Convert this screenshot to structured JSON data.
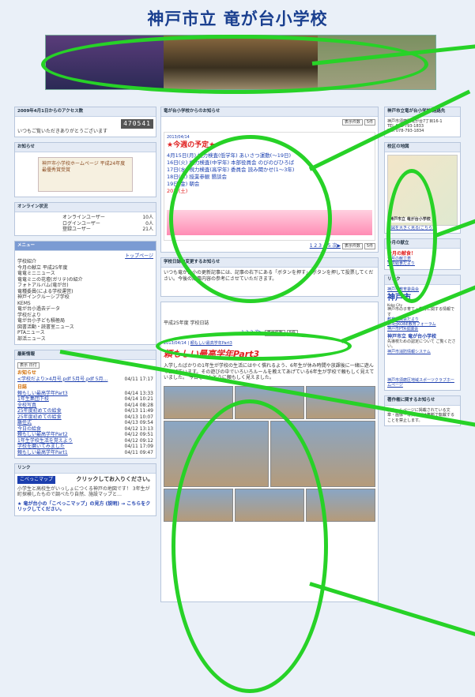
{
  "school_name": "神戸市立 竜が台小学校",
  "left": {
    "access": {
      "title": "2009年4月1日からのアクセス数",
      "count": "470541",
      "thanks": "いつもご覧いただきありがとうございます"
    },
    "award": {
      "title": "お知らせ",
      "text": "神戸市小学校ホームページ 平成24年度最優秀賞受賞"
    },
    "online": {
      "title": "オンライン状況",
      "rows": [
        {
          "label": "オンラインユーザー",
          "value": "10人"
        },
        {
          "label": "ログインユーザー",
          "value": "0人"
        },
        {
          "label": "登録ユーザー",
          "value": "21人"
        }
      ]
    },
    "menu": {
      "title": "メニュー",
      "top": "トップページ",
      "items": [
        "学校紹介",
        "今月の献立 平成25年度",
        "竜竜ミニニュース",
        "竜竜ミニの花壇(ガリテ)の紹介",
        "フォトアルバム(竜が台)",
        "竜種委員(による学校運営)",
        "神戸インクルーシブ学校",
        "KEMS",
        "竜が台小過去データ",
        "学校だより",
        "竜が台小子ども積極局",
        "図書活動・読書室ニュース",
        "PTAニュース",
        "部活ニュース"
      ]
    },
    "recent": {
      "title": "最新情報",
      "select": "表示 日付",
      "oshirase": "お知らせ",
      "oshirase_item": "<学校だより>4月号.pdf 5月号.pdf 5月…",
      "oshirase_date": "04/11 17:17",
      "nisshi_title": "日誌",
      "entries": [
        {
          "t": "頼もしい最高学年Part3",
          "d": "04/14 13:33"
        },
        {
          "t": "1年生集団下校",
          "d": "04/14 10:21"
        },
        {
          "t": "全校写真",
          "d": "04/14 08:28"
        },
        {
          "t": "25年度初めての給食",
          "d": "04/13 11:49"
        },
        {
          "t": "25年度初めての給食",
          "d": "04/13 10:07"
        },
        {
          "t": "離任式",
          "d": "04/13 09:54"
        },
        {
          "t": "今日の給食",
          "d": "04/12 13:13"
        },
        {
          "t": "頼もしい最高学年Part2",
          "d": "04/12 09:51"
        },
        {
          "t": "1年生学校生活を覚えよう",
          "d": "04/12 09:12"
        },
        {
          "t": "学校を磨いてみました",
          "d": "04/11 17:09"
        },
        {
          "t": "頼もしい最高学年Part1",
          "d": "04/11 09:47"
        }
      ]
    },
    "link": {
      "title": "リンク",
      "map_label": "こべっこマップ",
      "click_text": "クリックしてお入りください。",
      "desc": "小学生と高校生がいっしょにつくる神戸の地図です！ 3年生が町探検したもので調べたり自然、施設マップと…",
      "bottom_text": "★ 竜が台小の「こべっこマップ」の見方 (説明) → こちらをクリックしてください。"
    }
  },
  "center": {
    "notice_title": "竜が台小学校からのお知らせ",
    "schedule_date": "2013/04/14",
    "schedule_head": "★今週の予定★",
    "schedule_lines": [
      "4月15日(月) 視力検査(低学年) あいさつ運動(～19日)",
      "16日(火) 視力検査(中学年) 本部役員会 のびのびひろば",
      "17日(水) 視力検査(高学年) 委員会 読み聞かせ(1～3年)",
      "18日(木) 授業参観 懇談会",
      "19日(金) 朝会",
      "20日(土)"
    ],
    "pager": "1 2 3 4 5 次▶",
    "pager_select": "表示件数",
    "count_label": "5件",
    "nisshi_note_title": "学校日誌の変更するお知らせ",
    "nisshi_note": "いつも竜が台小の更新記事には、記事の右下にある「ボタンを押す」 ボタンを押して投票してください。今後の記事内容の参考にさせていただきます。",
    "diary_heading": "平成25年度 学校日誌",
    "diary_pager": "1 2 3 次▶",
    "diary_date": "2013/04/14",
    "diary_cat": "頼もしい最高学年Part3",
    "diary_title": "頼もしい最高学年Part3",
    "diary_text": "入学したばかりの1年生が学校の生活にはやく慣れるよう、6年生が休み時間や放課後に一緒に遊んであげています。その遊びの中でいろいろルールを教えてあげている6年生が学校で頼もしく見えていました。 今日もほんとうに頼もしく見えました。"
  },
  "right": {
    "info_title": "神戸市立竜が台小学校 連絡先",
    "address": "神戸市須磨区竜が台7丁目16-1",
    "tel": "TEL 078-793-1833",
    "fax": "FAX 078-793-1834",
    "map_title": "校区の地図",
    "map_label": "神戸市立 竜が台小学校",
    "map_link": "地図を大きく見る(こちら)",
    "menu_title": "今月の献立",
    "menu_head": "今月の献食！",
    "menu_items": [
      "今月の献立表",
      "学校給食だより"
    ],
    "links_title": "リンク",
    "links": [
      "神戸市教育委員会",
      "教育委員会だより",
      "第3回KOBE教育フォーラム",
      "神戸市PTA協議会",
      "神戸市立竜が台小学校",
      "神戸市消防情報システム",
      "神戸市須磨区地域スポーツクラブホームページ"
    ],
    "kobe_logo": "神戸市",
    "kobe_sub": "Kobe City",
    "kobe_desc": "神戸市の子育て・教育に関する情報です",
    "ryu_logo": "神戸市立 竜が台小学校",
    "ryu_desc": "先導校ための認定について ご覧ください。",
    "last_title": "著作権に関するお知らせ",
    "last_text": "当ホームページに掲載されている文章・画像・写真などは無断で転載することを禁止します。"
  }
}
